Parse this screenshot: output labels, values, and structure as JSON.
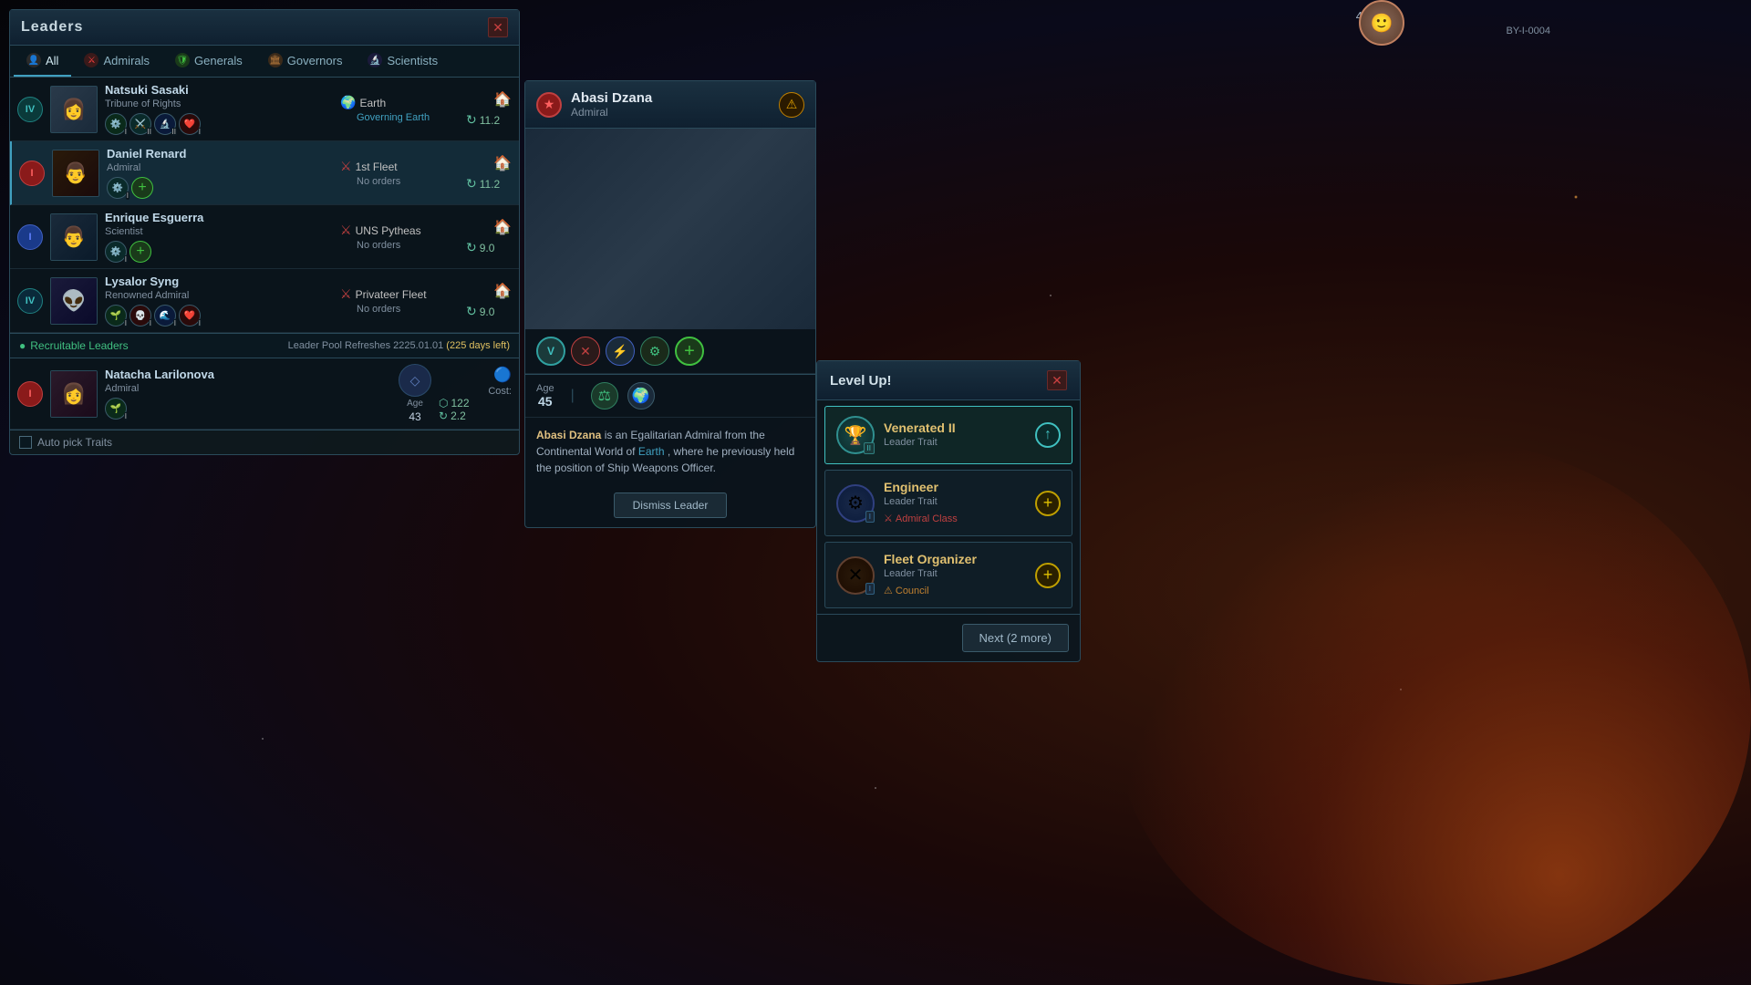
{
  "app": {
    "title": "Leaders"
  },
  "hud": {
    "system_id": "BY-I-0004",
    "coord": "4-956"
  },
  "tabs": [
    {
      "id": "all",
      "label": "All",
      "icon": "👤",
      "active": true
    },
    {
      "id": "admirals",
      "label": "Admirals",
      "icon": "⚔️",
      "active": false
    },
    {
      "id": "generals",
      "label": "Generals",
      "icon": "🛡️",
      "active": false
    },
    {
      "id": "governors",
      "label": "Governors",
      "icon": "🏛️",
      "active": false
    },
    {
      "id": "scientists",
      "label": "Scientists",
      "icon": "🔬",
      "active": false
    }
  ],
  "leaders": [
    {
      "id": "natsuki",
      "name": "Natsuki Sasaki",
      "title": "Tribune of Rights",
      "assignment": "Earth",
      "assignment_status": "Governing Earth",
      "assignment_type": "home",
      "level_badge": "IV",
      "badge_class": "badge-teal",
      "portrait_class": "portrait-natsuki",
      "portrait_emoji": "👩",
      "cost": "11.2",
      "traits": [
        "⚙️",
        "⚔️",
        "🔬",
        "❤️"
      ]
    },
    {
      "id": "daniel",
      "name": "Daniel Renard",
      "title": "Admiral",
      "assignment": "1st Fleet",
      "assignment_status": "No orders",
      "assignment_type": "fleet",
      "level_badge": "I",
      "badge_class": "badge-red",
      "portrait_class": "portrait-daniel",
      "portrait_emoji": "👨",
      "cost": "11.2",
      "traits": [
        "⚙️",
        "➕"
      ]
    },
    {
      "id": "enrique",
      "name": "Enrique Esguerra",
      "title": "Scientist",
      "assignment": "UNS Pytheas",
      "assignment_status": "No orders",
      "assignment_type": "fleet",
      "level_badge": "I",
      "badge_class": "badge-blue",
      "portrait_class": "portrait-enrique",
      "portrait_emoji": "👨",
      "cost": "9.0",
      "traits": [
        "⚙️",
        "➕"
      ]
    },
    {
      "id": "lysalor",
      "name": "Lysalor Syng",
      "title": "Renowned Admiral",
      "assignment": "Privateer Fleet",
      "assignment_status": "No orders",
      "assignment_type": "fleet",
      "level_badge": "IV",
      "badge_class": "badge-teal",
      "portrait_class": "portrait-lysalor",
      "portrait_emoji": "👽",
      "cost": "9.0",
      "traits": [
        "🌱",
        "💀",
        "🌊",
        "❤️"
      ]
    }
  ],
  "recruitable_section": {
    "title": "Recruitable Leaders",
    "refresh_label": "Leader Pool Refreshes 2225.01.01",
    "days_left": "(225 days left)"
  },
  "recruitable_leaders": [
    {
      "id": "natacha",
      "name": "Natacha Larilonova",
      "title": "Admiral",
      "level_badge": "I",
      "badge_class": "badge-red",
      "portrait_class": "portrait-natacha",
      "portrait_emoji": "👩",
      "age_label": "Age",
      "age": "43",
      "cost_label": "Cost:",
      "cost_unity": "122",
      "cost_influence": "2.2",
      "traits": [
        "🌱"
      ]
    }
  ],
  "auto_pick": {
    "label": "Auto pick Traits"
  },
  "selected_leader": {
    "name": "Abasi Dzana",
    "role": "Admiral",
    "age_label": "Age",
    "age": "45",
    "bio": "Abasi Dzana is an Egalitarian Admiral from the Continental World of Earth, where he previously held the position of Ship Weapons Officer.",
    "bio_name": "Abasi Dzana",
    "bio_world": "Earth",
    "dismiss_label": "Dismiss Leader",
    "traits": [
      "V",
      "✕",
      "⚡",
      "⚙️"
    ],
    "has_alert": true
  },
  "levelup": {
    "title": "Level Up!",
    "choices": [
      {
        "id": "venerated2",
        "name": "Venerated II",
        "type": "Leader Trait",
        "tag": null,
        "tag_icon": null,
        "icon_emoji": "🏆",
        "icon_class": "tc-teal",
        "badge": "II",
        "badge_class": "badge-ii",
        "is_selected": true
      },
      {
        "id": "engineer",
        "name": "Engineer",
        "type": "Leader Trait",
        "tag": "Admiral Class",
        "tag_icon": "⚔️",
        "tag_color": "red",
        "icon_emoji": "⚙️",
        "icon_class": "tc-blue",
        "badge": "I",
        "badge_class": "badge-i",
        "is_selected": false
      },
      {
        "id": "fleet_organizer",
        "name": "Fleet Organizer",
        "type": "Leader Trait",
        "tag": "Council",
        "tag_icon": "⚠️",
        "tag_color": "orange",
        "icon_emoji": "✕",
        "icon_class": "tc-dark",
        "badge": "I",
        "badge_class": "badge-i",
        "is_selected": false
      }
    ],
    "next_button": "Next (2 more)"
  }
}
